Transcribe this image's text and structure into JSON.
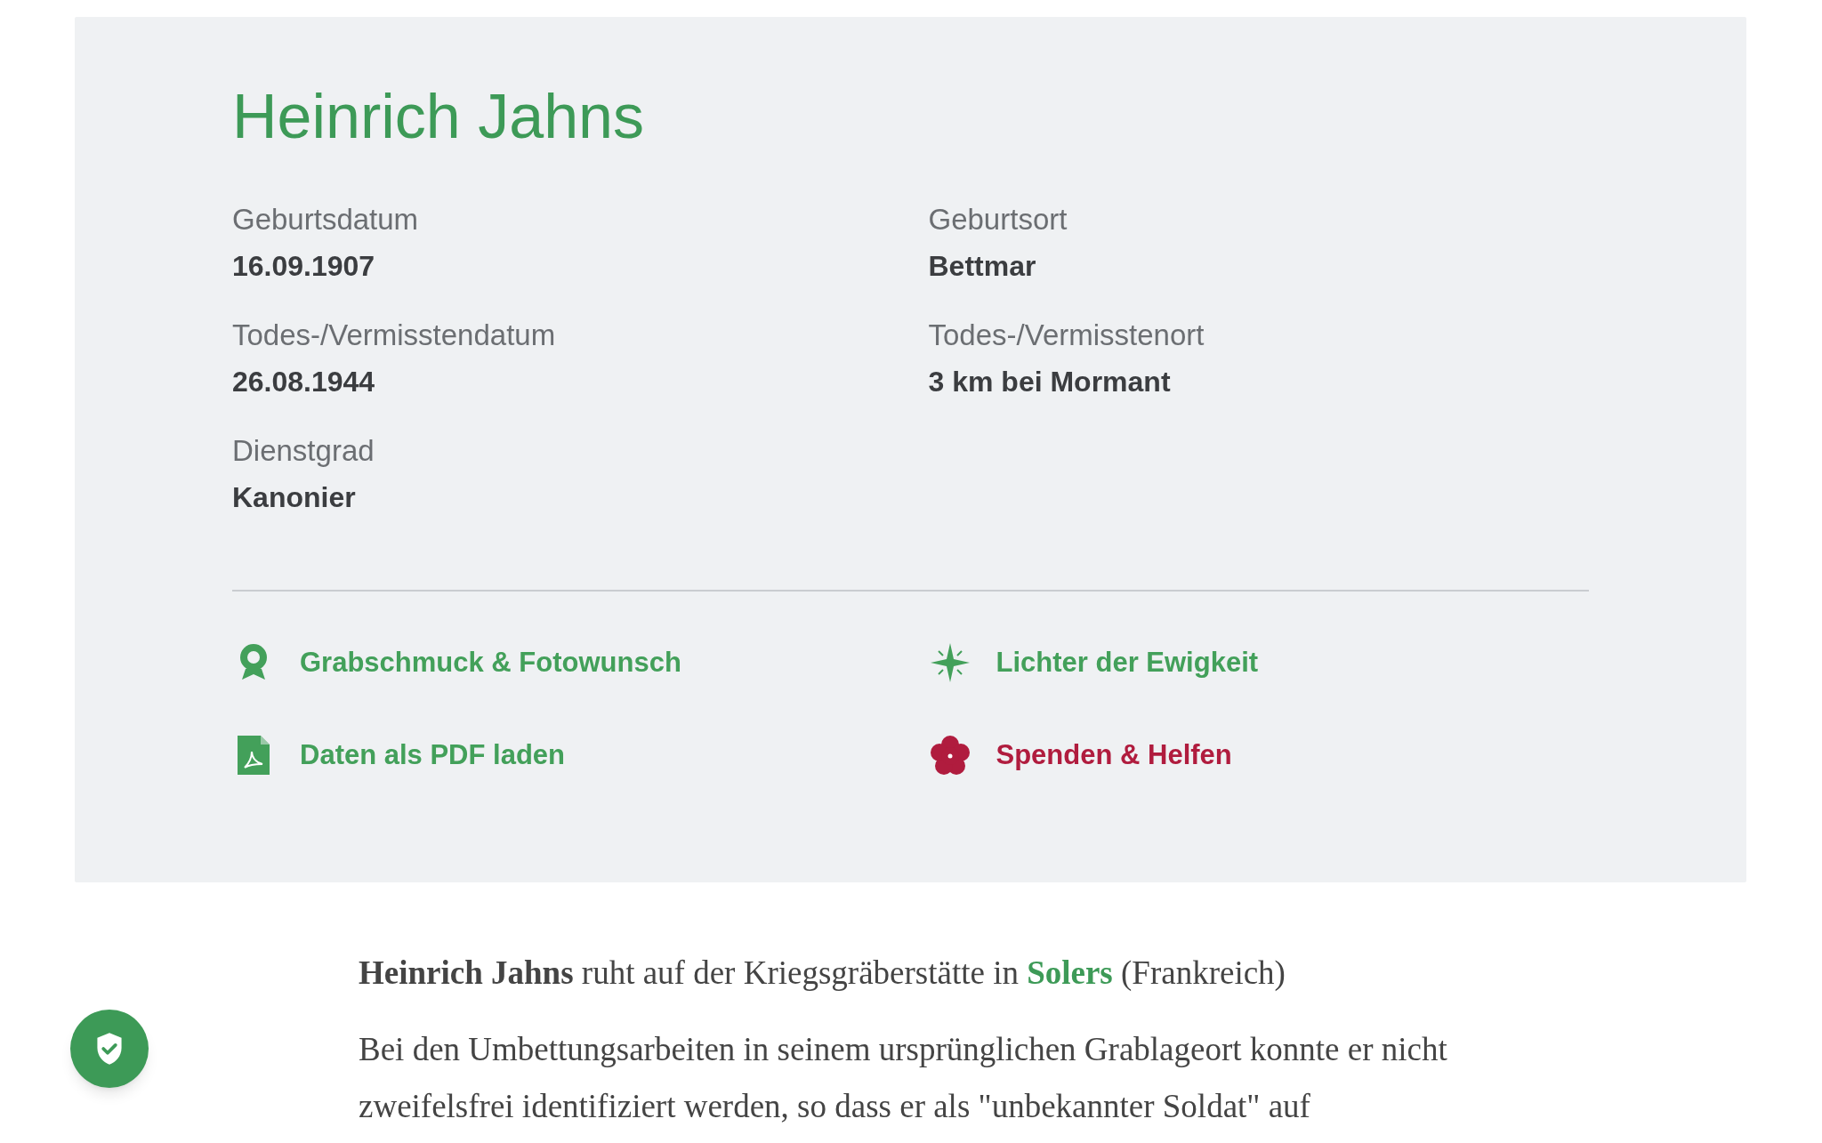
{
  "card": {
    "title": "Heinrich Jahns",
    "facts": [
      {
        "label": "Geburtsdatum",
        "value": "16.09.1907"
      },
      {
        "label": "Geburtsort",
        "value": "Bettmar"
      },
      {
        "label": "Todes-/Vermisstendatum",
        "value": "26.08.1944"
      },
      {
        "label": "Todes-/Vermisstenort",
        "value": "3 km bei Mormant"
      },
      {
        "label": "Dienstgrad",
        "value": "Kanonier"
      }
    ],
    "links": [
      {
        "kind": "wreath",
        "label": "Grabschmuck & Fotowunsch",
        "color": "#43a05a"
      },
      {
        "kind": "star",
        "label": "Lichter der Ewigkeit",
        "color": "#43a05a"
      },
      {
        "kind": "pdf",
        "label": "Daten als PDF laden",
        "color": "#43a05a"
      },
      {
        "kind": "flower",
        "label": "Spenden & Helfen",
        "color": "#b01c3e"
      }
    ]
  },
  "resting": {
    "before": "**Heinrich Jahns** ruht auf der Kriegsgräberstätte in ",
    "link": "Solers",
    "after": " (Frankreich)"
  },
  "paragraph": "Bei den Umbettungsarbeiten in seinem ursprünglichen Grablageort konnte er nicht zweifelsfrei identifiziert werden, so dass er als \"unbekannter Soldat\" auf"
}
